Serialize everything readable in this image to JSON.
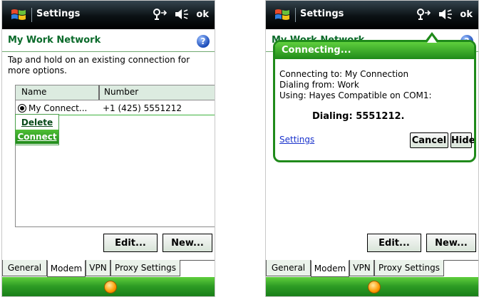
{
  "left": {
    "titlebar": {
      "title": "Settings",
      "ok_label": "ok"
    },
    "header": {
      "title": "My Work Network"
    },
    "instructions": "Tap and hold on an existing connection for more options.",
    "list": {
      "columns": [
        "Name",
        "Number"
      ],
      "rows": [
        {
          "name": "My Connect...",
          "number": "+1 (425) 5551212"
        }
      ]
    },
    "context_menu": {
      "items": [
        "Delete",
        "Connect"
      ]
    },
    "buttons": {
      "edit": "Edit...",
      "new": "New..."
    },
    "tabs": [
      "General",
      "Modem",
      "VPN",
      "Proxy Settings"
    ],
    "active_tab": "Modem"
  },
  "right": {
    "titlebar": {
      "title": "Settings",
      "ok_label": "ok"
    },
    "header": {
      "title": "My Work Network"
    },
    "dialog": {
      "title": "Connecting...",
      "lines": [
        "Connecting to: My Connection",
        "Dialing from: Work",
        "Using: Hayes Compatible on COM1:"
      ],
      "status": "Dialing: 5551212.",
      "settings_link": "Settings",
      "cancel_label": "Cancel",
      "hide_label": "Hide"
    },
    "buttons": {
      "edit": "Edit...",
      "new": "New..."
    },
    "tabs": [
      "General",
      "Modem",
      "VPN",
      "Proxy Settings"
    ],
    "active_tab": "Modem"
  },
  "icons": {
    "start": "windows-start-icon",
    "connectivity": "connectivity-icon",
    "volume": "speaker-icon",
    "help": "help-icon",
    "home": "home-orb-icon"
  },
  "colors": {
    "accent_green": "#1f8a1a",
    "header_text": "#0a6a2a",
    "titlebar": "#0b1114",
    "link": "#1a33cc"
  }
}
